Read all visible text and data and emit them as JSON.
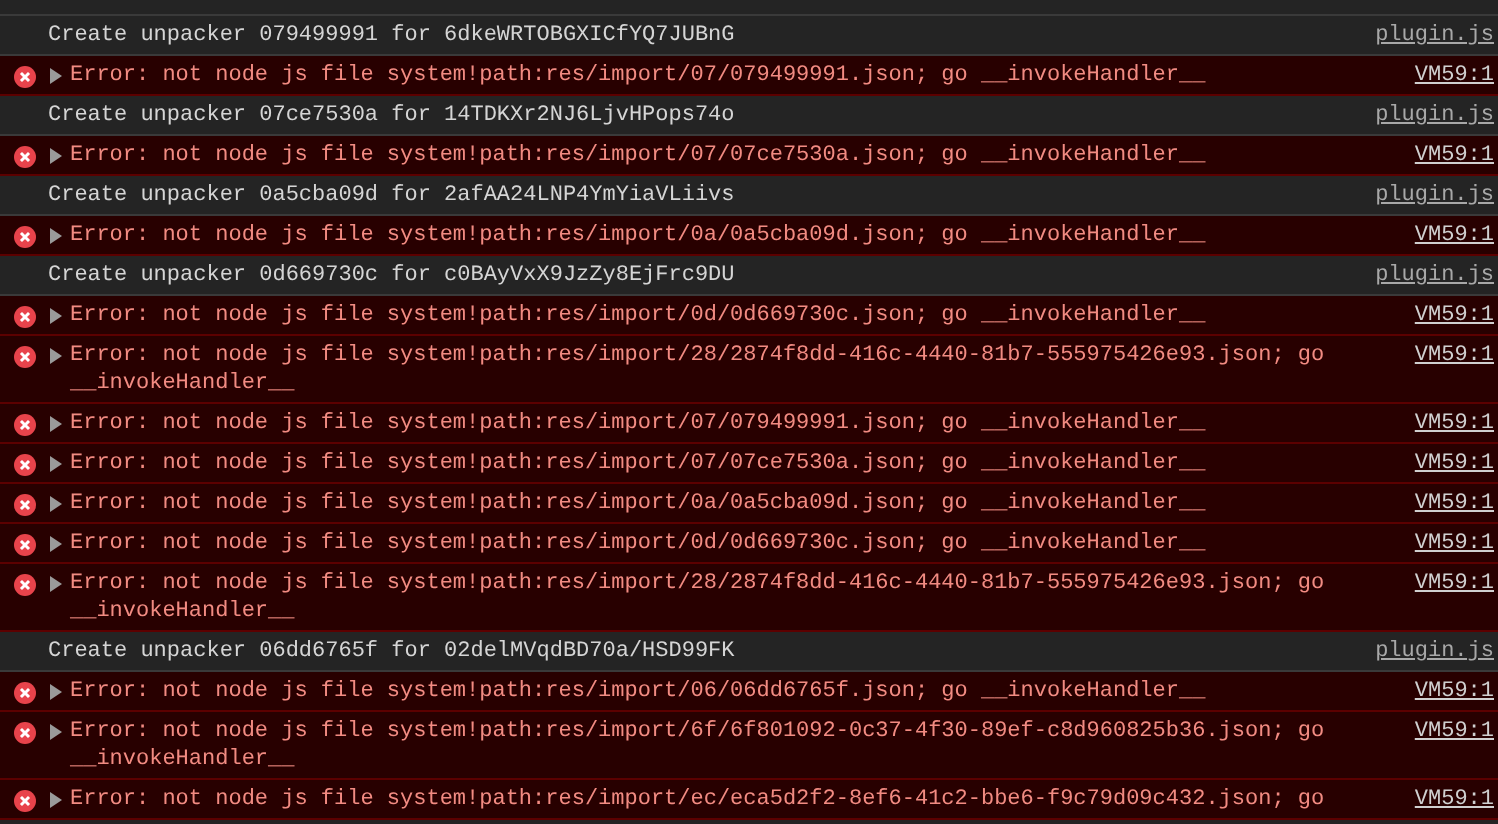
{
  "console_entries": [
    {
      "kind": "log",
      "message": "Create unpacker 079499991 for 6dkeWRTOBGXICfYQ7JUBnG",
      "source": "plugin.js"
    },
    {
      "kind": "error",
      "message": "Error: not node js file system!path:res/import/07/079499991.json; go __invokeHandler__",
      "source": "VM59:1"
    },
    {
      "kind": "log",
      "message": "Create unpacker 07ce7530a for 14TDKXr2NJ6LjvHPops74o",
      "source": "plugin.js"
    },
    {
      "kind": "error",
      "message": "Error: not node js file system!path:res/import/07/07ce7530a.json; go __invokeHandler__",
      "source": "VM59:1"
    },
    {
      "kind": "log",
      "message": "Create unpacker 0a5cba09d for 2afAA24LNP4YmYiaVLiivs",
      "source": "plugin.js"
    },
    {
      "kind": "error",
      "message": "Error: not node js file system!path:res/import/0a/0a5cba09d.json; go __invokeHandler__",
      "source": "VM59:1"
    },
    {
      "kind": "log",
      "message": "Create unpacker 0d669730c for c0BAyVxX9JzZy8EjFrc9DU",
      "source": "plugin.js"
    },
    {
      "kind": "error",
      "message": "Error: not node js file system!path:res/import/0d/0d669730c.json; go __invokeHandler__",
      "source": "VM59:1"
    },
    {
      "kind": "error",
      "message": "Error: not node js file system!path:res/import/28/2874f8dd-416c-4440-81b7-555975426e93.json; go __invokeHandler__",
      "source": "VM59:1"
    },
    {
      "kind": "error",
      "message": "Error: not node js file system!path:res/import/07/079499991.json; go __invokeHandler__",
      "source": "VM59:1"
    },
    {
      "kind": "error",
      "message": "Error: not node js file system!path:res/import/07/07ce7530a.json; go __invokeHandler__",
      "source": "VM59:1"
    },
    {
      "kind": "error",
      "message": "Error: not node js file system!path:res/import/0a/0a5cba09d.json; go __invokeHandler__",
      "source": "VM59:1"
    },
    {
      "kind": "error",
      "message": "Error: not node js file system!path:res/import/0d/0d669730c.json; go __invokeHandler__",
      "source": "VM59:1"
    },
    {
      "kind": "error",
      "message": "Error: not node js file system!path:res/import/28/2874f8dd-416c-4440-81b7-555975426e93.json; go __invokeHandler__",
      "source": "VM59:1"
    },
    {
      "kind": "log",
      "message": "Create unpacker 06dd6765f for 02delMVqdBD70a/HSD99FK",
      "source": "plugin.js"
    },
    {
      "kind": "error",
      "message": "Error: not node js file system!path:res/import/06/06dd6765f.json; go __invokeHandler__",
      "source": "VM59:1"
    },
    {
      "kind": "error",
      "message": "Error: not node js file system!path:res/import/6f/6f801092-0c37-4f30-89ef-c8d960825b36.json; go __invokeHandler__",
      "source": "VM59:1"
    },
    {
      "kind": "error",
      "message": "Error: not node js file system!path:res/import/ec/eca5d2f2-8ef6-41c2-bbe6-f9c79d09c432.json; go",
      "source": "VM59:1"
    }
  ]
}
